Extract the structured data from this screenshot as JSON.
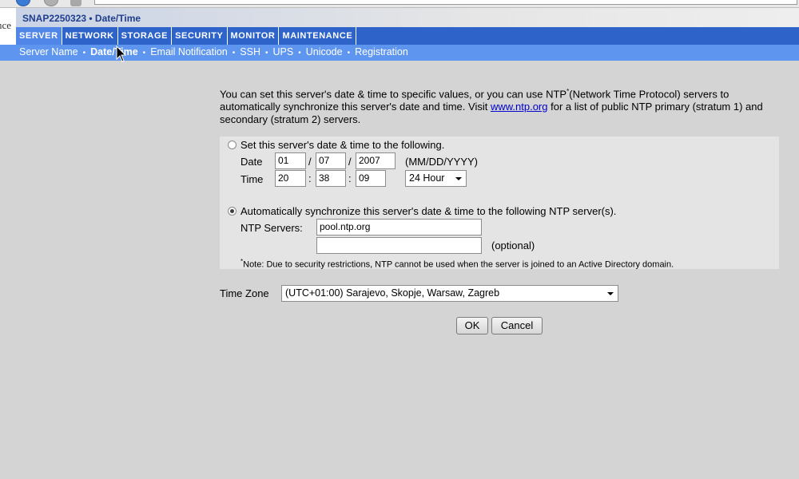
{
  "window": {
    "title": "SNAP2250323 • Date/Time",
    "logo_fragment": "nce"
  },
  "main_nav": {
    "tabs": [
      {
        "label": "SERVER",
        "active": true
      },
      {
        "label": "NETWORK",
        "active": false
      },
      {
        "label": "STORAGE",
        "active": false
      },
      {
        "label": "SECURITY",
        "active": false
      },
      {
        "label": "MONITOR",
        "active": false
      },
      {
        "label": "MAINTENANCE",
        "active": false
      }
    ]
  },
  "sub_nav": {
    "separator": "•",
    "items": [
      {
        "label": "Server Name",
        "active": false
      },
      {
        "label": "Date/Time",
        "active": true
      },
      {
        "label": "Email Notification",
        "active": false
      },
      {
        "label": "SSH",
        "active": false
      },
      {
        "label": "UPS",
        "active": false
      },
      {
        "label": "Unicode",
        "active": false
      },
      {
        "label": "Registration",
        "active": false
      }
    ]
  },
  "intro": {
    "part1": "You can set this server's date & time to specific values, or you can use NTP",
    "asterisk": "*",
    "part2": "(Network Time Protocol) servers to automatically synchronize this server's date and time. Visit ",
    "link": "www.ntp.org",
    "part3": " for a list of public NTP primary (stratum 1) and secondary (stratum 2) servers."
  },
  "manual": {
    "radio_label": "Set this server's date & time to the following.",
    "selected": false,
    "date_label": "Date",
    "month": "01",
    "day": "07",
    "year": "2007",
    "date_sep": "/",
    "date_format": "(MM/DD/YYYY)",
    "time_label": "Time",
    "hour": "20",
    "minute": "38",
    "second": "09",
    "time_sep": ":",
    "clock_format": "24 Hour"
  },
  "ntp": {
    "radio_label": "Automatically synchronize this server's date & time to the following NTP server(s).",
    "selected": true,
    "servers_label": "NTP Servers:",
    "server1": "pool.ntp.org",
    "server2": "",
    "optional_label": "(optional)",
    "note_mark": "*",
    "note": "Note: Due to security restrictions, NTP cannot be used when the server is joined to an Active Directory domain."
  },
  "timezone": {
    "label": "Time Zone",
    "value": "(UTC+01:00) Sarajevo, Skopje, Warsaw, Zagreb"
  },
  "buttons": {
    "ok": "OK",
    "cancel": "Cancel"
  }
}
